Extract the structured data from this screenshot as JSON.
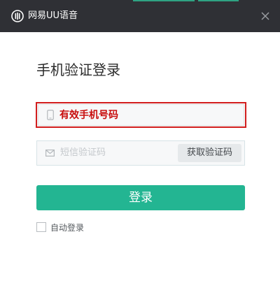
{
  "window": {
    "title": "网易UU语音",
    "logo_icon": "uu-logo-icon",
    "close_icon": "close-icon"
  },
  "login": {
    "heading": "手机验证登录",
    "phone_value": "有效手机号码",
    "phone_icon": "phone-icon",
    "code_placeholder": "短信验证码",
    "code_icon": "mail-icon",
    "get_code_label": "获取验证码",
    "submit_label": "登录",
    "auto_login_label": "自动登录",
    "auto_login_checked": false
  },
  "colors": {
    "titlebar": "#2f3035",
    "accent": "#23b592",
    "error_border": "#d21e1e",
    "error_text": "#c80c0c"
  }
}
